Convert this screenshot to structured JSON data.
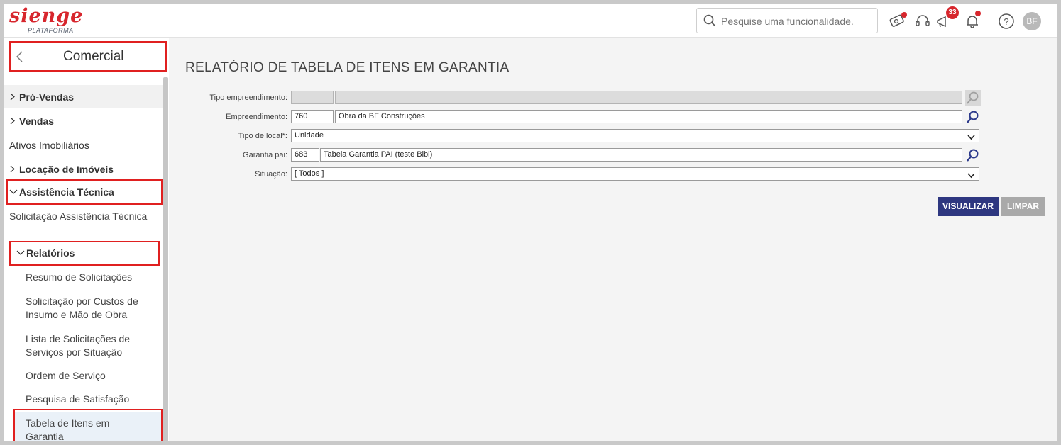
{
  "header": {
    "logo": "sienge",
    "logo_sub": "PLATAFORMA",
    "search_placeholder": "Pesquise uma funcionalidade.",
    "notification_count": "33",
    "avatar_initials": "BF",
    "accent_color": "#d7262d"
  },
  "sidebar": {
    "module_title": "Comercial",
    "items": [
      {
        "label": "Pró-Vendas",
        "chevron": ">"
      },
      {
        "label": "Vendas",
        "chevron": ">"
      },
      {
        "label": "Ativos Imobiliários",
        "chevron": ""
      },
      {
        "label": "Locação de Imóveis",
        "chevron": ">"
      },
      {
        "label": "Assistência Técnica",
        "chevron": "v"
      }
    ],
    "assistencia_items": [
      "Solicitação Assistência Técnica"
    ],
    "relatorios_label": "Relatórios",
    "relatorios_items": [
      "Resumo de Solicitações",
      "Solicitação por Custos de Insumo e Mão de Obra",
      "Lista de Solicitações de Serviços por Situação",
      "Ordem de Serviço",
      "Pesquisa de Satisfação",
      "Tabela de Itens em Garantia"
    ]
  },
  "main": {
    "title": "RELATÓRIO DE TABELA DE ITENS EM GARANTIA",
    "fields": {
      "tipo_empreendimento": {
        "label": "Tipo empreendimento:",
        "code": "",
        "name": ""
      },
      "empreendimento": {
        "label": "Empreendimento:",
        "code": "760",
        "name": "Obra da BF Construções"
      },
      "tipo_local": {
        "label": "Tipo de local*:",
        "value": "Unidade"
      },
      "garantia_pai": {
        "label": "Garantia pai:",
        "code": "683",
        "name": "Tabela Garantia PAI (teste Bibi)"
      },
      "situacao": {
        "label": "Situação:",
        "value": "[ Todos ]"
      }
    },
    "buttons": {
      "visualizar": "VISUALIZAR",
      "limpar": "LIMPAR"
    },
    "colors": {
      "primary_button": "#2e3780",
      "disabled_button": "#a9a9a9",
      "lookup_icon": "#2c3a8c"
    }
  }
}
